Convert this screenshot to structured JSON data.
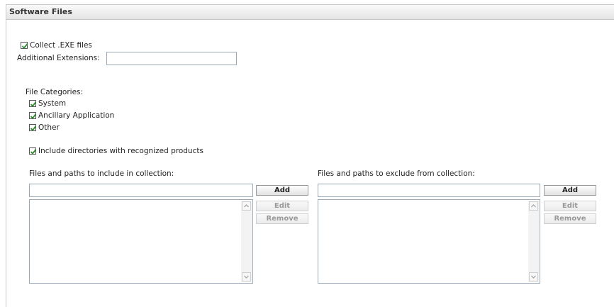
{
  "panel": {
    "title": "Software Files"
  },
  "collect_exe": {
    "label": "Collect .EXE files",
    "checked": true
  },
  "additional_extensions": {
    "label": "Additional Extensions:",
    "value": ""
  },
  "file_categories": {
    "label": "File Categories:",
    "items": [
      {
        "label": "System",
        "checked": true
      },
      {
        "label": "Ancillary Application",
        "checked": true
      },
      {
        "label": "Other",
        "checked": true
      }
    ]
  },
  "include_directories": {
    "label": "Include directories with recognized products",
    "checked": true
  },
  "include_section": {
    "label": "Files and paths to include in collection:",
    "input_value": "",
    "add_label": "Add",
    "edit_label": "Edit",
    "remove_label": "Remove"
  },
  "exclude_section": {
    "label": "Files and paths to exclude from collection:",
    "input_value": "",
    "add_label": "Add",
    "edit_label": "Edit",
    "remove_label": "Remove"
  },
  "colors": {
    "check": "#2e8b2e",
    "border": "#9aa8b5"
  }
}
